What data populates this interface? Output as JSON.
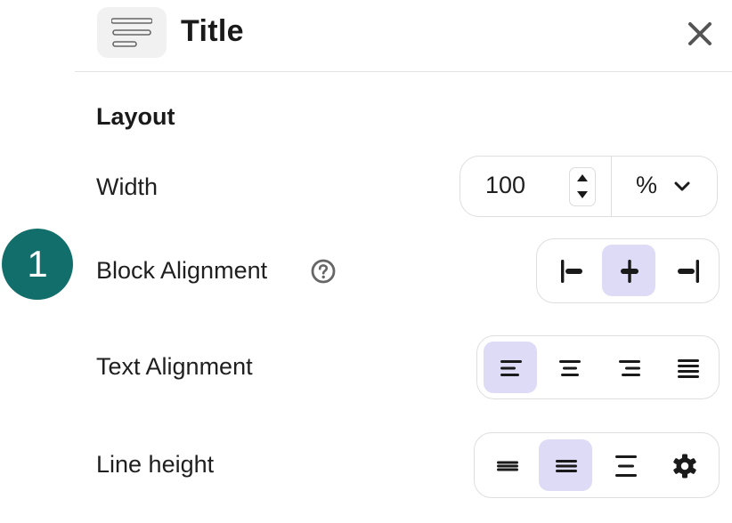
{
  "header": {
    "title": "Title"
  },
  "section": {
    "title": "Layout"
  },
  "width": {
    "label": "Width",
    "value": "100",
    "unit": "%"
  },
  "block_alignment": {
    "label": "Block Alignment",
    "step_number": "1",
    "options": [
      "align-left",
      "align-center",
      "align-right"
    ],
    "selected": "align-center"
  },
  "text_alignment": {
    "label": "Text Alignment",
    "options": [
      "left",
      "center",
      "right",
      "justify"
    ],
    "selected": "left"
  },
  "line_height": {
    "label": "Line height",
    "options": [
      "compact",
      "normal",
      "loose",
      "custom"
    ],
    "selected": "normal"
  },
  "colors": {
    "accent": "#dedbf7",
    "badge": "#126e6a",
    "text": "#1f1f1f"
  }
}
